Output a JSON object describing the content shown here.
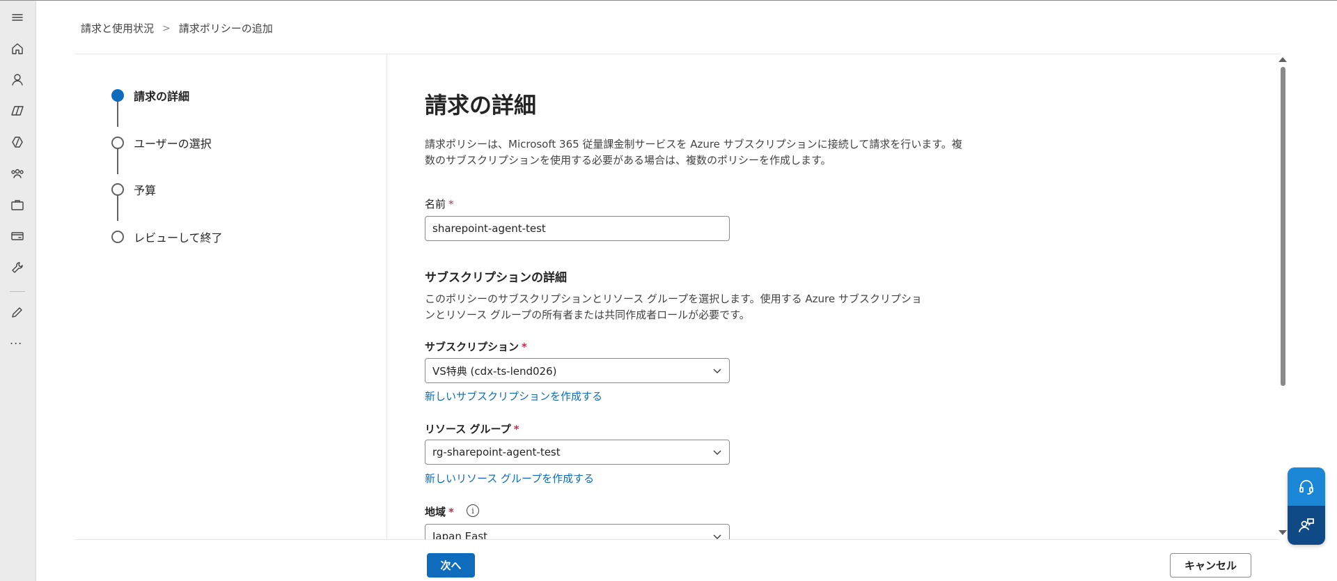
{
  "breadcrumb": {
    "parent": "請求と使用状況",
    "separator": ">",
    "current": "請求ポリシーの追加"
  },
  "rail": {
    "icons": [
      "menu-icon",
      "home-icon",
      "user-icon",
      "copilot-icon",
      "agents-icon",
      "teams-icon",
      "briefcase-icon",
      "billing-card-icon",
      "wrench-icon",
      "pencil-icon"
    ],
    "more": "..."
  },
  "steps": [
    {
      "label": "請求の詳細",
      "state": "current"
    },
    {
      "label": "ユーザーの選択",
      "state": "pending"
    },
    {
      "label": "予算",
      "state": "pending"
    },
    {
      "label": "レビューして終了",
      "state": "pending"
    }
  ],
  "main": {
    "title": "請求の詳細",
    "intro_line1": "請求ポリシーは、Microsoft 365 従量課金制サービスを Azure サブスクリプションに接続して請求を行います。複",
    "intro_line2": "数のサブスクリプションを使用する必要がある場合は、複数のポリシーを作成します。",
    "name_label": "名前",
    "required_mark": "*",
    "name_value": "sharepoint-agent-test",
    "section_title": "サブスクリプションの詳細",
    "section_desc_line1": "このポリシーのサブスクリプションとリソース グループを選択します。使用する Azure サブスクリプショ",
    "section_desc_line2": "ンとリソース グループの所有者または共同作成者ロールが必要です。",
    "subscription_label": "サブスクリプション",
    "subscription_value": "VS特典 (cdx-ts-lend026)",
    "create_subscription_link": "新しいサブスクリプションを作成する",
    "resource_group_label": "リソース グループ",
    "resource_group_value": "rg-sharepoint-agent-test",
    "create_resource_group_link": "新しいリソース グループを作成する",
    "region_label": "地域",
    "region_value": "Japan East",
    "info_glyph": "i"
  },
  "footer": {
    "next_label": "次へ",
    "cancel_label": "キャンセル"
  },
  "colors": {
    "accent": "#0f6cbd",
    "required": "#c4314b",
    "help_top": "#1a86d6",
    "help_bottom": "#0f4a86"
  }
}
